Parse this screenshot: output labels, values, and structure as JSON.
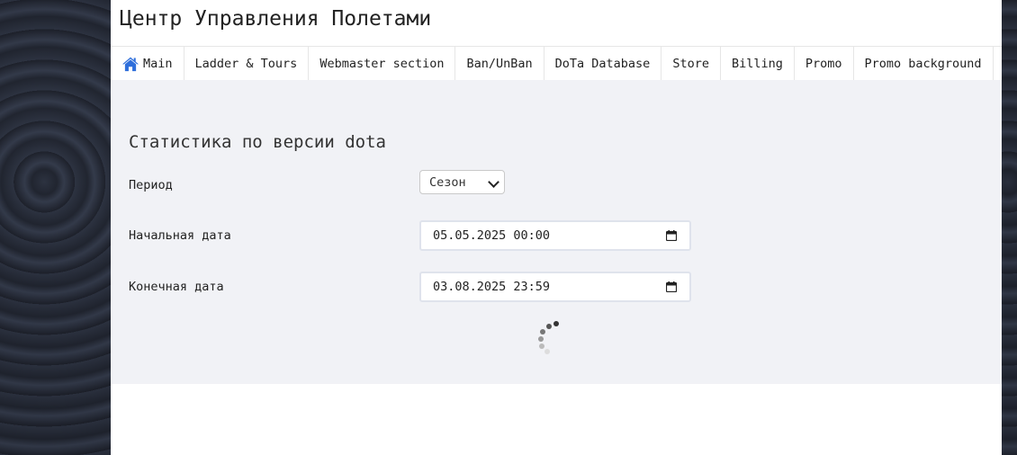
{
  "header": {
    "title": "Центр Управления Полетами"
  },
  "nav": {
    "items": [
      {
        "label": "Main",
        "icon": "home-icon",
        "icon_color": "#2f6fdb"
      },
      {
        "label": "Ladder & Tours"
      },
      {
        "label": "Webmaster section"
      },
      {
        "label": "Ban/UnBan"
      },
      {
        "label": "DoTa Database"
      },
      {
        "label": "Store"
      },
      {
        "label": "Billing"
      },
      {
        "label": "Promo"
      },
      {
        "label": "Promo background"
      }
    ]
  },
  "stats": {
    "title": "Статистика по версии dota",
    "period": {
      "label": "Период",
      "selected": "Сезон"
    },
    "start_date": {
      "label": "Начальная дата",
      "value": "05.05.2025 00:00"
    },
    "end_date": {
      "label": "Конечная дата",
      "value": "03.08.2025 23:59"
    },
    "loading_icon": "spinner-icon"
  }
}
